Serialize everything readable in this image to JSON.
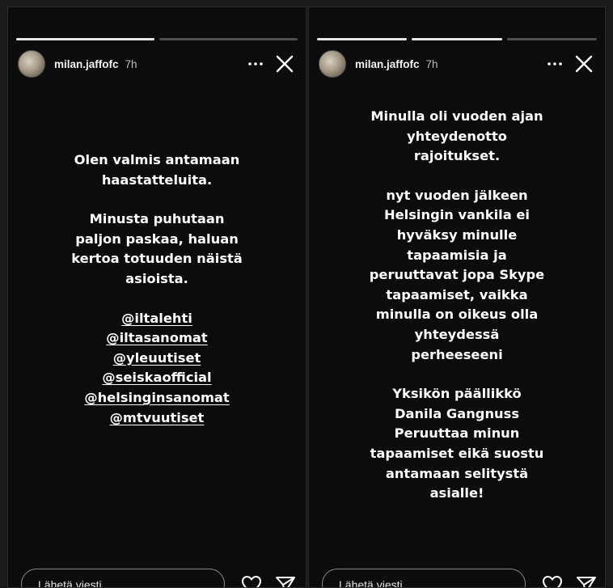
{
  "stories": [
    {
      "username": "milan.jaffofc",
      "time": "7h",
      "progress": [
        1.0,
        0.0
      ],
      "paragraphs": [
        [
          "Olen valmis antamaan",
          "haastatteluita."
        ],
        [
          "Minusta puhutaan",
          "paljon paskaa, haluan",
          "kertoa totuuden näistä",
          "asioista."
        ]
      ],
      "mentions": [
        "@iltalehti",
        "@iltasanomat",
        "@yleuutiset",
        "@seiskaofficial",
        "@helsinginsanomat",
        "@mtvuutiset"
      ],
      "reply_placeholder": "Lähetä viesti"
    },
    {
      "username": "milan.jaffofc",
      "time": "7h",
      "progress": [
        1.0,
        1.0,
        0.0
      ],
      "paragraphs": [
        [
          "Minulla oli vuoden ajan",
          "yhteydenotto",
          "rajoitukset."
        ],
        [
          "nyt vuoden jälkeen",
          "Helsingin vankila ei",
          "hyväksy minulle",
          "tapaamisia ja",
          "peruuttavat jopa Skype",
          "tapaamiset, vaikka",
          "minulla on oikeus olla",
          "yhteydessä",
          "perheeseeni"
        ],
        [
          "Yksikön päällikkö",
          "Danila Gangnuss",
          "Peruuttaa minun",
          "tapaamiset eikä suostu",
          "antamaan selitystä",
          "asialle!"
        ]
      ],
      "reply_placeholder": "Lähetä viesti"
    }
  ],
  "icons": {
    "more": "more-horizontal-icon",
    "close": "close-icon",
    "like": "heart-icon",
    "send": "send-icon"
  },
  "colors": {
    "story_background": "#0c0c0c",
    "text": "#ffffff"
  }
}
